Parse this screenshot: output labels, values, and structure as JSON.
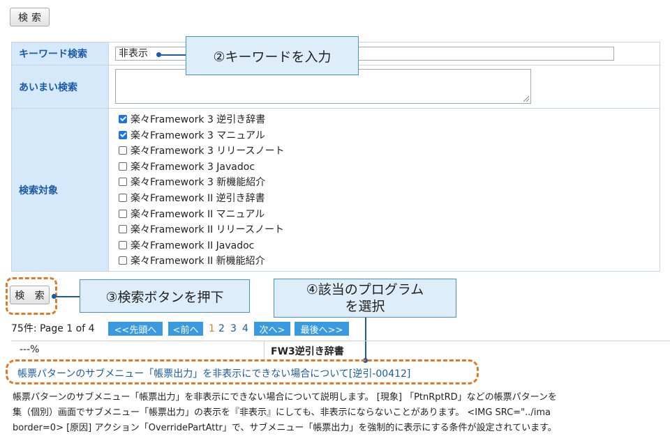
{
  "top_search_button": "検索",
  "form": {
    "keyword_label": "キーワード検索",
    "keyword_value": "非表示",
    "fuzzy_label": "あいまい検索",
    "fuzzy_value": "",
    "target_label": "検索対象",
    "targets": [
      {
        "label": "楽々Framework 3 逆引き辞書",
        "checked": true
      },
      {
        "label": "楽々Framework 3 マニュアル",
        "checked": true
      },
      {
        "label": "楽々Framework 3 リリースノート",
        "checked": false
      },
      {
        "label": "楽々Framework 3 Javadoc",
        "checked": false
      },
      {
        "label": "楽々Framework 3 新機能紹介",
        "checked": false
      },
      {
        "label": "楽々Framework II 逆引き辞書",
        "checked": false
      },
      {
        "label": "楽々Framework II マニュアル",
        "checked": false
      },
      {
        "label": "楽々Framework II リリースノート",
        "checked": false
      },
      {
        "label": "楽々Framework II Javadoc",
        "checked": false
      },
      {
        "label": "楽々Framework II 新機能紹介",
        "checked": false
      }
    ]
  },
  "bottom_search_button": "検 索",
  "callouts": {
    "keyword": "②キーワードを入力",
    "search": "③検索ボタンを押下",
    "select_line1": "④該当のプログラム",
    "select_line2": "を選択"
  },
  "pagination": {
    "summary": "75件: Page 1 of 4",
    "first": "<<先頭へ",
    "prev": "<前へ",
    "pages": [
      "1",
      "2",
      "3",
      "4"
    ],
    "current": "1",
    "next": "次へ>",
    "last": "最後へ>>"
  },
  "results": {
    "col_score": "---%",
    "col_category": "FW3逆引き辞書",
    "title_link": "帳票パターンのサブメニュー「帳票出力」を非表示にできない場合について[逆引-00412]",
    "snippet_line1": "帳票パターンのサブメニュー「帳票出力」を非表示にできない場合について説明します。 [現象] 「PtnRptRD」などの帳票パターンを",
    "snippet_line2": "集（個別）画面でサブメニュー「帳票出力」の表示を『非表示』にしても、非表示にならないことがあります。 <IMG SRC=\"../ima",
    "snippet_line3": "border=0> [原因] アクション「OverridePartAttr」で、サブメニュー「帳票出力」を強制的に表示にする条件が設定されています。"
  },
  "colors": {
    "label_bg": "#d6e9fb",
    "label_text": "#1a5aa6",
    "callout_bg": "#ddeefa",
    "callout_border": "#4a90c8",
    "highlight": "#e07a28",
    "pager_bg": "#3a9ae0",
    "link": "#1a5aa6"
  }
}
